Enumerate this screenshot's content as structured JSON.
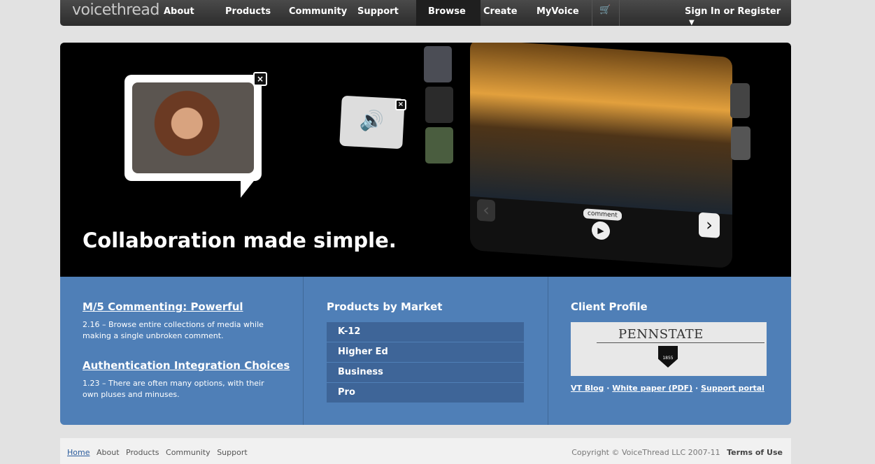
{
  "brand": "voicethread",
  "nav": {
    "items": [
      "About",
      "Products",
      "Community",
      "Support",
      "Browse",
      "Create",
      "MyVoice"
    ],
    "signin": "Sign In or Register"
  },
  "hero": {
    "title": "Collaboration made simple.",
    "comment_chip": "comment"
  },
  "news": [
    {
      "title": "M/5 Commenting: Powerful",
      "body": "2.16 – Browse entire collections of media while making a single unbroken comment."
    },
    {
      "title": "Authentication Integration Choices",
      "body": "1.23 – There are often many options, with their own pluses and minuses."
    }
  ],
  "markets": {
    "title": "Products by Market",
    "items": [
      "K-12",
      "Higher Ed",
      "Business",
      "Pro"
    ]
  },
  "client": {
    "title": "Client Profile",
    "logo_text": "PENNSTATE",
    "seal_year": "1855",
    "links": [
      "VT Blog",
      "White paper (PDF)",
      "Support portal"
    ]
  },
  "footer": {
    "links": [
      "Home",
      "About",
      "Products",
      "Community",
      "Support"
    ],
    "copyright": "Copyright © VoiceThread LLC 2007-11",
    "terms": "Terms of Use"
  },
  "colors": {
    "accent_blue": "#4f7fb7",
    "market_button": "#3e6598",
    "nav_dark": "#2c2c2c"
  }
}
